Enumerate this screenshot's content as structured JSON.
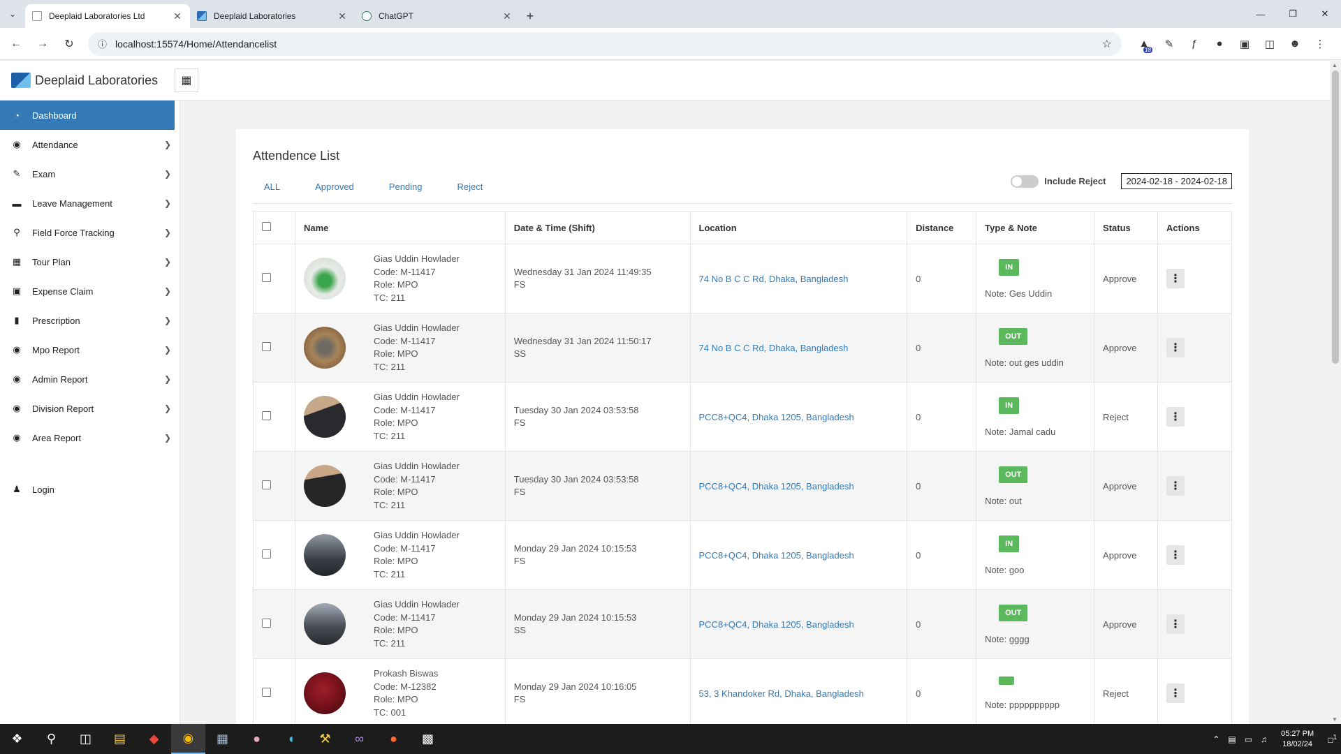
{
  "browser": {
    "tabs": [
      {
        "title": "Deeplaid Laboratories Ltd",
        "active": true,
        "favicon": "page-icon"
      },
      {
        "title": "Deeplaid Laboratories",
        "active": false,
        "favicon": "logo-icon"
      },
      {
        "title": "ChatGPT",
        "active": false,
        "favicon": "chatgpt-icon"
      }
    ],
    "url": "localhost:15574/Home/Attendancelist",
    "extension_badge": "18"
  },
  "app": {
    "brand": "Deeplaid Laboratories"
  },
  "sidebar": {
    "items": [
      {
        "label": "Dashboard",
        "icon": "dashboard-icon",
        "active": true,
        "chevron": false
      },
      {
        "label": "Attendance",
        "icon": "target-icon",
        "chevron": true
      },
      {
        "label": "Exam",
        "icon": "edit-icon",
        "chevron": true
      },
      {
        "label": "Leave Management",
        "icon": "bed-icon",
        "chevron": true
      },
      {
        "label": "Field Force Tracking",
        "icon": "map-marker-icon",
        "chevron": true
      },
      {
        "label": "Tour Plan",
        "icon": "calendar-icon",
        "chevron": true
      },
      {
        "label": "Expense Claim",
        "icon": "money-icon",
        "chevron": true
      },
      {
        "label": "Prescription",
        "icon": "file-icon",
        "chevron": true
      },
      {
        "label": "Mpo Report",
        "icon": "eye-icon",
        "chevron": true
      },
      {
        "label": "Admin Report",
        "icon": "eye-icon",
        "chevron": true
      },
      {
        "label": "Division Report",
        "icon": "eye-icon",
        "chevron": true
      },
      {
        "label": "Area Report",
        "icon": "eye-icon",
        "chevron": true
      }
    ],
    "login": {
      "label": "Login",
      "icon": "user-icon"
    }
  },
  "attendance": {
    "title": "Attendence List",
    "filters": [
      "ALL",
      "Approved",
      "Pending",
      "Reject"
    ],
    "include_reject_label": "Include Reject",
    "date_range": "2024-02-18 - 2024-02-18",
    "columns": [
      "Name",
      "Date & Time (Shift)",
      "Location",
      "Distance",
      "Type & Note",
      "Status",
      "Actions"
    ],
    "rows": [
      {
        "name": "Gias Uddin Howlader",
        "code": "Code: M-11417",
        "role": "Role: MPO",
        "tc": "TC: 211",
        "datetime": "Wednesday 31 Jan 2024 11:49:35",
        "shift": "FS",
        "location": "74 No B C C Rd, Dhaka, Bangladesh",
        "distance": "0",
        "type": "IN",
        "note": "Note: Ges Uddin",
        "status": "Approve"
      },
      {
        "name": "Gias Uddin Howlader",
        "code": "Code: M-11417",
        "role": "Role: MPO",
        "tc": "TC: 211",
        "datetime": "Wednesday 31 Jan 2024 11:50:17",
        "shift": "SS",
        "location": "74 No B C C Rd, Dhaka, Bangladesh",
        "distance": "0",
        "type": "OUT",
        "note": "Note: out ges uddin",
        "status": "Approve"
      },
      {
        "name": "Gias Uddin Howlader",
        "code": "Code: M-11417",
        "role": "Role: MPO",
        "tc": "TC: 211",
        "datetime": "Tuesday 30 Jan 2024 03:53:58",
        "shift": "FS",
        "location": "PCC8+QC4, Dhaka 1205, Bangladesh",
        "distance": "0",
        "type": "IN",
        "note": "Note: Jamal cadu",
        "status": "Reject"
      },
      {
        "name": "Gias Uddin Howlader",
        "code": "Code: M-11417",
        "role": "Role: MPO",
        "tc": "TC: 211",
        "datetime": "Tuesday 30 Jan 2024 03:53:58",
        "shift": "FS",
        "location": "PCC8+QC4, Dhaka 1205, Bangladesh",
        "distance": "0",
        "type": "OUT",
        "note": "Note: out",
        "status": "Approve"
      },
      {
        "name": "Gias Uddin Howlader",
        "code": "Code: M-11417",
        "role": "Role: MPO",
        "tc": "TC: 211",
        "datetime": "Monday 29 Jan 2024 10:15:53",
        "shift": "FS",
        "location": "PCC8+QC4, Dhaka 1205, Bangladesh",
        "distance": "0",
        "type": "IN",
        "note": "Note: goo",
        "status": "Approve"
      },
      {
        "name": "Gias Uddin Howlader",
        "code": "Code: M-11417",
        "role": "Role: MPO",
        "tc": "TC: 211",
        "datetime": "Monday 29 Jan 2024 10:15:53",
        "shift": "SS",
        "location": "PCC8+QC4, Dhaka 1205, Bangladesh",
        "distance": "0",
        "type": "OUT",
        "note": "Note: gggg",
        "status": "Approve"
      },
      {
        "name": "Prokash Biswas",
        "code": "Code: M-12382",
        "role": "Role: MPO",
        "tc": "TC: 001",
        "datetime": "Monday 29 Jan 2024 10:16:05",
        "shift": "FS",
        "location": "53, 3 Khandoker Rd, Dhaka, Bangladesh",
        "distance": "0",
        "type": "",
        "note": "Note: pppppppppp",
        "status": "Reject"
      }
    ]
  },
  "taskbar": {
    "time": "05:27 PM",
    "date": "18/02/24",
    "notification_count": "1"
  },
  "colors": {
    "primary": "#337ab7",
    "badge_green": "#5cb85c",
    "taskbar": "#1c1c1c"
  }
}
